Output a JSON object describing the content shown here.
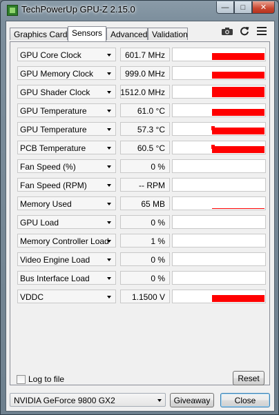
{
  "window": {
    "title": "TechPowerUp GPU-Z 2.15.0",
    "minimize": "—",
    "maximize": "□",
    "close": "✕"
  },
  "tabs": [
    {
      "label": "Graphics Card",
      "active": false
    },
    {
      "label": "Sensors",
      "active": true
    },
    {
      "label": "Advanced",
      "active": false
    },
    {
      "label": "Validation",
      "active": false
    }
  ],
  "toolbar": {
    "icons": [
      "camera-icon",
      "refresh-icon",
      "menu-icon"
    ]
  },
  "accent_color": "#ff0000",
  "sensors": [
    {
      "label": "GPU Core Clock",
      "value": "601.7 MHz",
      "graph": {
        "level": 0.55,
        "spike": false
      }
    },
    {
      "label": "GPU Memory Clock",
      "value": "999.0 MHz",
      "graph": {
        "level": 0.55,
        "spike": false
      }
    },
    {
      "label": "GPU Shader Clock",
      "value": "1512.0 MHz",
      "graph": {
        "level": 0.85,
        "spike": false
      }
    },
    {
      "label": "GPU Temperature",
      "value": "61.0 °C",
      "graph": {
        "level": 0.55,
        "spike": false
      }
    },
    {
      "label": "GPU Temperature",
      "value": "57.3 °C",
      "graph": {
        "level": 0.55,
        "spike": true
      }
    },
    {
      "label": "PCB Temperature",
      "value": "60.5 °C",
      "graph": {
        "level": 0.55,
        "spike": true
      }
    },
    {
      "label": "Fan Speed (%)",
      "value": "0 %",
      "graph": {
        "level": 0,
        "spike": false
      }
    },
    {
      "label": "Fan Speed (RPM)",
      "value": "-- RPM",
      "graph": {
        "level": 0,
        "spike": false
      }
    },
    {
      "label": "Memory Used",
      "value": "65 MB",
      "graph": {
        "level": 0.07,
        "spike": false
      }
    },
    {
      "label": "GPU Load",
      "value": "0 %",
      "graph": {
        "level": 0,
        "spike": false
      }
    },
    {
      "label": "Memory Controller Load",
      "value": "1 %",
      "graph": {
        "level": 0,
        "spike": false
      }
    },
    {
      "label": "Video Engine Load",
      "value": "0 %",
      "graph": {
        "level": 0,
        "spike": false
      }
    },
    {
      "label": "Bus Interface Load",
      "value": "0 %",
      "graph": {
        "level": 0,
        "spike": false
      }
    },
    {
      "label": "VDDC",
      "value": "1.1500 V",
      "graph": {
        "level": 0.55,
        "spike": false
      }
    }
  ],
  "footer": {
    "log_label": "Log to file",
    "log_checked": false,
    "reset_label": "Reset",
    "gpu_select": "NVIDIA GeForce 9800 GX2",
    "giveaway_label": "Giveaway",
    "close_label": "Close"
  }
}
